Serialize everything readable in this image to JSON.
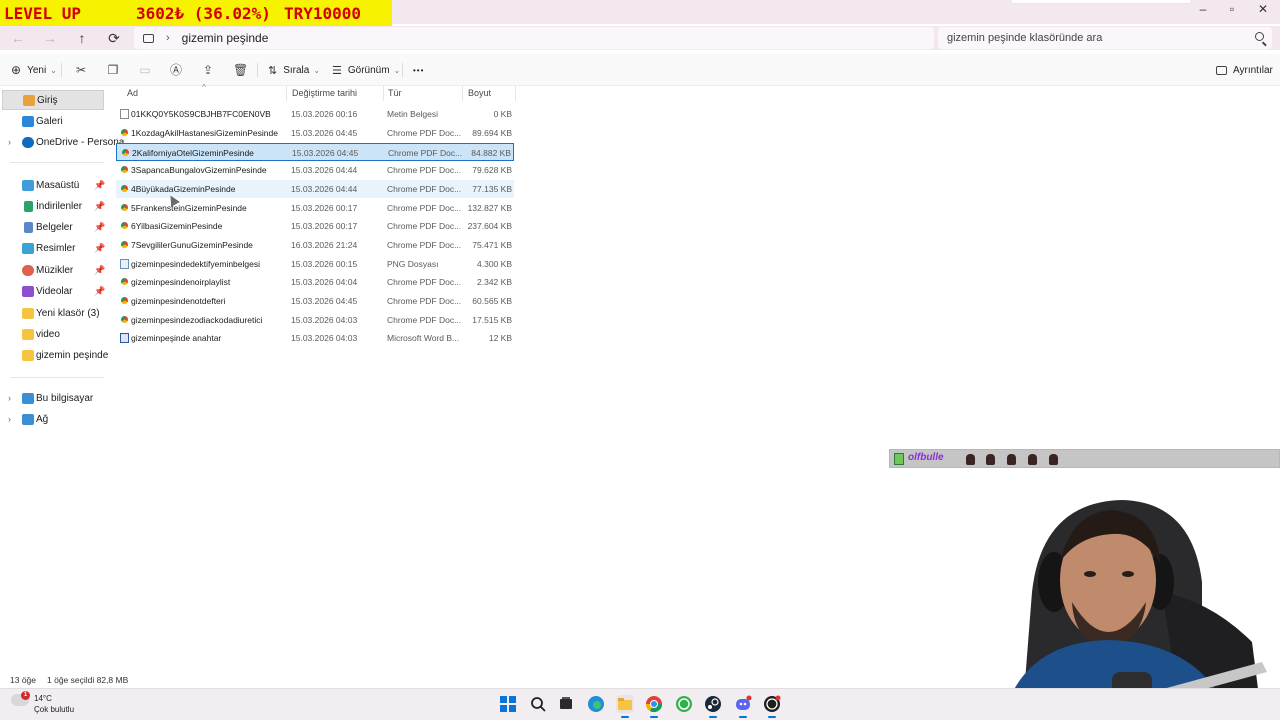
{
  "stream_banner": {
    "text1": "LEVEL UP",
    "text2": "3602₺ (36.02%)",
    "text3": "TRY10000"
  },
  "window_controls": {
    "minimize": "–",
    "maximize": "▫",
    "close": "✕"
  },
  "nav": {
    "back": "←",
    "forward": "→",
    "up": "↑",
    "refresh": "⟳"
  },
  "address": {
    "chevron": "›",
    "crumb": "gizemin peşinde"
  },
  "search": {
    "placeholder": "gizemin peşinde klasöründe ara"
  },
  "toolbar": {
    "new_label": "Yeni",
    "new_icon": "⊕",
    "new_chevron": "⌄",
    "sort_label": "Sırala",
    "sort_chevron": "⌄",
    "view_label": "Görünüm",
    "view_chevron": "⌄",
    "more_label": "•••",
    "details_label": "Ayrıntılar"
  },
  "sidebar": {
    "expander": "›",
    "pin": "📌",
    "items": [
      {
        "label": "Giriş",
        "icon": "home-icon",
        "color": "#e9a23b"
      },
      {
        "label": "Galeri",
        "icon": "gallery-icon",
        "color": "#2b88d8"
      },
      {
        "label": "OneDrive - Persona",
        "icon": "onedrive-icon",
        "color": "#0f6cbd"
      },
      {
        "label": "Masaüstü",
        "icon": "desktop-icon",
        "color": "#3f9ddb"
      },
      {
        "label": "İndirilenler",
        "icon": "downloads-icon",
        "color": "#2ba36b"
      },
      {
        "label": "Belgeler",
        "icon": "documents-icon",
        "color": "#5c87c7"
      },
      {
        "label": "Resimler",
        "icon": "pictures-icon",
        "color": "#3aa3d6"
      },
      {
        "label": "Müzikler",
        "icon": "music-icon",
        "color": "#e0604e"
      },
      {
        "label": "Videolar",
        "icon": "videos-icon",
        "color": "#8c4fd0"
      },
      {
        "label": "Yeni klasör (3)",
        "icon": "folder-icon",
        "color": "#f5c542"
      },
      {
        "label": "video",
        "icon": "folder-icon",
        "color": "#f5c542"
      },
      {
        "label": "gizemin peşinde",
        "icon": "folder-icon",
        "color": "#f5c542"
      },
      {
        "label": "Bu bilgisayar",
        "icon": "this-pc-icon",
        "color": "#3a8fd4"
      },
      {
        "label": "Ağ",
        "icon": "network-icon",
        "color": "#3a8fd4"
      }
    ]
  },
  "columns": {
    "name": "Ad",
    "sort_indicator": "^",
    "date": "Değiştirme tarihi",
    "type": "Tür",
    "size": "Boyut"
  },
  "files": [
    {
      "name": "01KKQ0Y5K0S9CBJHB7FC0EN0VB",
      "date": "15.03.2026 00:16",
      "type": "Metin Belgesi",
      "size": "0 KB",
      "kind": "txt"
    },
    {
      "name": "1KozdagAkilHastanesiGizeminPesinde",
      "date": "15.03.2026 04:45",
      "type": "Chrome PDF Doc...",
      "size": "89.694 KB",
      "kind": "pdf"
    },
    {
      "name": "2KaliforniyaOtelGizeminPesinde",
      "date": "15.03.2026 04:45",
      "type": "Chrome PDF Doc...",
      "size": "84.882 KB",
      "kind": "pdf"
    },
    {
      "name": "3SapancaBungalovGizeminPesinde",
      "date": "15.03.2026 04:44",
      "type": "Chrome PDF Doc...",
      "size": "79.628 KB",
      "kind": "pdf"
    },
    {
      "name": "4BüyükadaGizeminPesinde",
      "date": "15.03.2026 04:44",
      "type": "Chrome PDF Doc...",
      "size": "77.135 KB",
      "kind": "pdf"
    },
    {
      "name": "5FrankensteinGizeminPesinde",
      "date": "15.03.2026 00:17",
      "type": "Chrome PDF Doc...",
      "size": "132.827 KB",
      "kind": "pdf"
    },
    {
      "name": "6YilbasiGizeminPesinde",
      "date": "15.03.2026 00:17",
      "type": "Chrome PDF Doc...",
      "size": "237.604 KB",
      "kind": "pdf"
    },
    {
      "name": "7SevgililerGunuGizeminPesinde",
      "date": "16.03.2026 21:24",
      "type": "Chrome PDF Doc...",
      "size": "75.471 KB",
      "kind": "pdf"
    },
    {
      "name": "gizeminpesindedektifyeminbelgesi",
      "date": "15.03.2026 00:15",
      "type": "PNG Dosyası",
      "size": "4.300 KB",
      "kind": "png"
    },
    {
      "name": "gizeminpesindenoirplaylist",
      "date": "15.03.2026 04:04",
      "type": "Chrome PDF Doc...",
      "size": "2.342 KB",
      "kind": "pdf"
    },
    {
      "name": "gizeminpesindenotdefteri",
      "date": "15.03.2026 04:45",
      "type": "Chrome PDF Doc...",
      "size": "60.565 KB",
      "kind": "pdf"
    },
    {
      "name": "gizeminpesindezodiackodadiuretici",
      "date": "15.03.2026 04:03",
      "type": "Chrome PDF Doc...",
      "size": "17.515 KB",
      "kind": "pdf"
    },
    {
      "name": "gizeminpeşinde anahtar",
      "date": "15.03.2026 04:03",
      "type": "Microsoft Word B...",
      "size": "12 KB",
      "kind": "word"
    }
  ],
  "status": {
    "count": "13 öğe",
    "selection": "1 öğe seçildi  82,8 MB"
  },
  "overlay": {
    "tag": "olfbulle"
  },
  "weather": {
    "badge": "1",
    "temp": "14°C",
    "desc": "Çok bulutlu"
  },
  "colors": {
    "selected_bg": "#cce4f7",
    "selected_border": "#1a73c7",
    "banner_bg": "#f7f300",
    "banner_text": "#d40000"
  }
}
